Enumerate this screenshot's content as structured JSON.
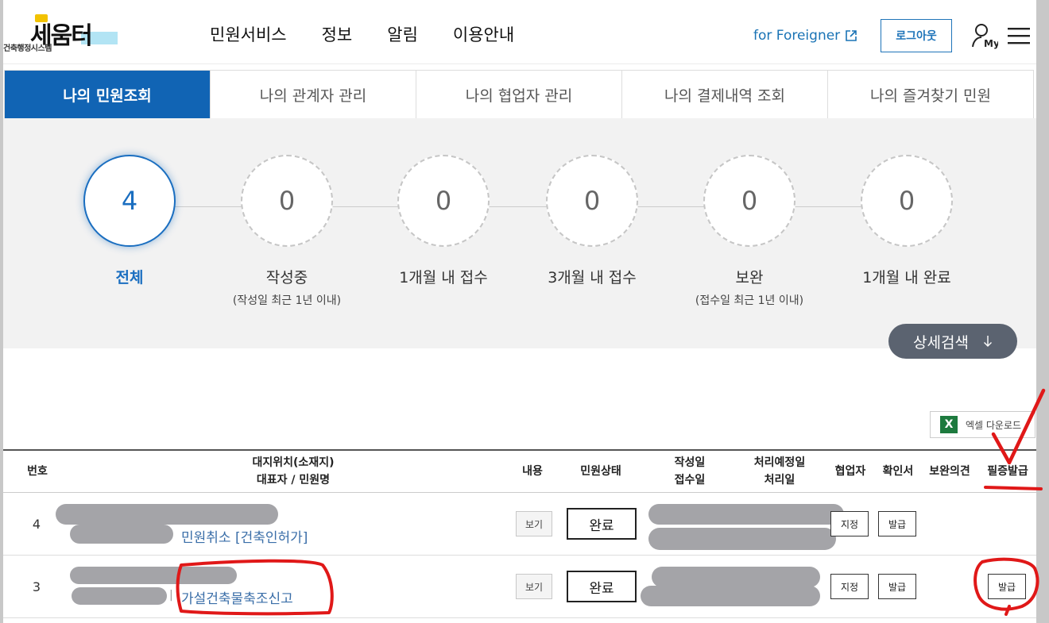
{
  "header": {
    "logo_main": "세움터",
    "logo_sub": "건축행정시스템",
    "nav": [
      "민원서비스",
      "정보",
      "알림",
      "이용안내"
    ],
    "foreigner": "for Foreigner",
    "logout": "로그아웃",
    "my_label": "My"
  },
  "tabs": [
    {
      "label": "나의 민원조회",
      "active": true
    },
    {
      "label": "나의 관계자 관리",
      "active": false
    },
    {
      "label": "나의 협업자 관리",
      "active": false
    },
    {
      "label": "나의 결제내역 조회",
      "active": false
    },
    {
      "label": "나의 즐겨찾기 민원",
      "active": false
    }
  ],
  "stats": [
    {
      "count": "4",
      "label": "전체",
      "sub": ""
    },
    {
      "count": "0",
      "label": "작성중",
      "sub": "(작성일 최근 1년 이내)"
    },
    {
      "count": "0",
      "label": "1개월 내 접수",
      "sub": ""
    },
    {
      "count": "0",
      "label": "3개월 내 접수",
      "sub": ""
    },
    {
      "count": "0",
      "label": "보완",
      "sub": "(접수일 최근 1년 이내)"
    },
    {
      "count": "0",
      "label": "1개월 내 완료",
      "sub": ""
    }
  ],
  "detail_search": "상세검색",
  "excel_download": "엑셀 다운로드",
  "table": {
    "headers": {
      "num": "번호",
      "location_line1": "대지위치(소재지)",
      "location_line2": "대표자 / 민원명",
      "content": "내용",
      "status": "민원상태",
      "dates_line1": "작성일",
      "dates_line2": "접수일",
      "due_line1": "처리예정일",
      "due_line2": "처리일",
      "collab": "협업자",
      "confirm": "확인서",
      "opinion": "보완의견",
      "certificate": "필증발급"
    },
    "rows": [
      {
        "num": "4",
        "name": "민원취소 [건축인허가]",
        "view": "보기",
        "status": "완료",
        "collab": "지정",
        "confirm": "발급",
        "certificate": ""
      },
      {
        "num": "3",
        "name": "가설건축물축조신고",
        "view": "보기",
        "status": "완료",
        "collab": "지정",
        "confirm": "발급",
        "certificate": "발급"
      }
    ]
  },
  "colors": {
    "primary": "#1164b4",
    "annotation": "#e01818",
    "detail_button": "#5b6370"
  }
}
